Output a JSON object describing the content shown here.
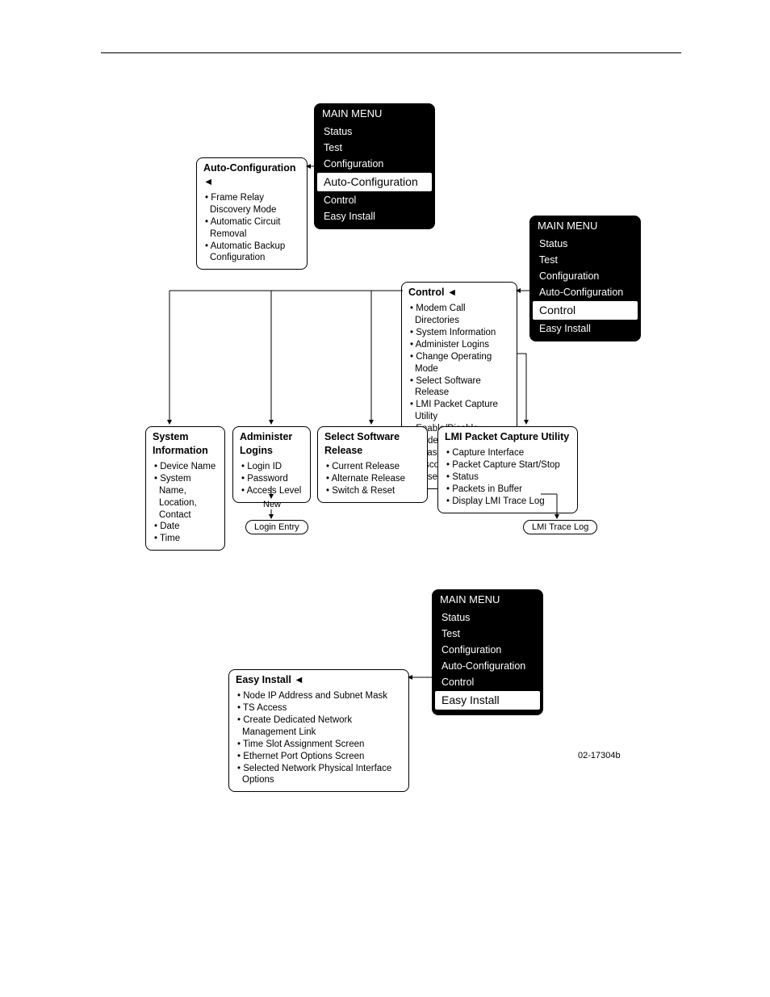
{
  "chart_data": {
    "type": "diagram",
    "description": "Menu hierarchy / navigation flowchart for a device management interface (MAIN MENU → Auto-Configuration, Control, Easy Install sub-trees)."
  },
  "menu1": {
    "title": "MAIN MENU",
    "i0": "Status",
    "i1": "Test",
    "i2": "Configuration",
    "hl": "Auto-Configuration",
    "i3": "Control",
    "i4": "Easy Install"
  },
  "autoConfig": {
    "title": "Auto-Configuration",
    "b0": "Frame Relay Discovery Mode",
    "b1": "Automatic Circuit Removal",
    "b2": "Automatic Backup Configuration"
  },
  "menu2": {
    "title": "MAIN MENU",
    "i0": "Status",
    "i1": "Test",
    "i2": "Configuration",
    "i3": "Auto-Configuration",
    "hl": "Control",
    "i4": "Easy Install"
  },
  "control": {
    "title": "Control",
    "l0": "Modem Call Directories",
    "l1": "System Information",
    "l2": "Administer Logins",
    "l3": "Change Operating Mode",
    "l4": "Select Software Release",
    "l5": "LMI Packet Capture Utility",
    "l6": "Enable/Disable Modem",
    "l7": "  PassThru to COM",
    "l8": "Disconnect Modem",
    "l9": "Reset Device"
  },
  "sysInfo": {
    "title": "System Information",
    "b0": "Device Name",
    "b1": "System Name, Location, Contact",
    "b2": "Date",
    "b3": "Time"
  },
  "admin": {
    "title": "Administer Logins",
    "b0": "Login ID",
    "b1": "Password",
    "b2": "Access Level",
    "new": "New",
    "login": "Login Entry"
  },
  "selSw": {
    "title": "Select Software Release",
    "b0": "Current Release",
    "b1": "Alternate Release",
    "b2": "Switch & Reset"
  },
  "lmi": {
    "title": "LMI Packet Capture Utility",
    "b0": "Capture Interface",
    "b1": "Packet Capture Start/Stop",
    "b2": "Status",
    "b3": "Packets in Buffer",
    "b4": "Display LMI Trace Log",
    "pill": "LMI Trace Log"
  },
  "menu3": {
    "title": "MAIN MENU",
    "i0": "Status",
    "i1": "Test",
    "i2": "Configuration",
    "i3": "Auto-Configuration",
    "i4": "Control",
    "hl": "Easy Install"
  },
  "easy": {
    "title": "Easy Install",
    "b0": "Node IP Address and Subnet Mask",
    "b1": "TS Access",
    "b2": "Create Dedicated Network Management Link",
    "b3": "Time Slot Assignment Screen",
    "b4": "Ethernet Port Options Screen",
    "b5": "Selected Network Physical Interface Options"
  },
  "figNum": "02-17304b"
}
